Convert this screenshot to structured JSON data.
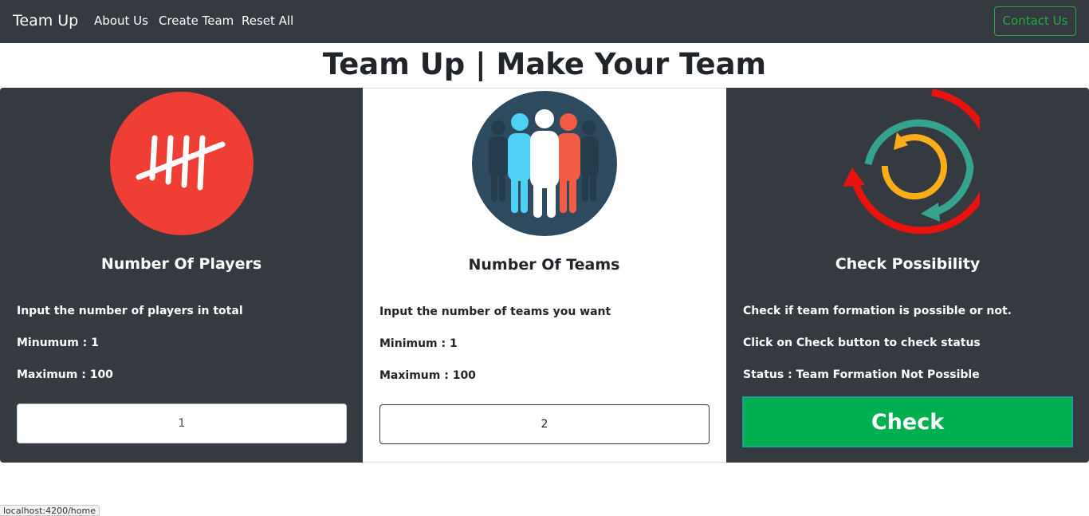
{
  "navbar": {
    "brand": "Team Up",
    "links": [
      "About Us",
      "Create Team",
      "Reset All"
    ],
    "contact_label": "Contact Us"
  },
  "page_title": "Team Up | Make Your Team",
  "cards": [
    {
      "icon": "tally-marks-icon",
      "title": "Number Of Players",
      "lines": [
        "Input the number of players in total",
        "Minumum : 1",
        "Maximum : 100"
      ],
      "input_value": "1"
    },
    {
      "icon": "people-group-icon",
      "title": "Number Of Teams",
      "lines": [
        "Input the number of teams you want",
        "Minimum : 1",
        "Maximum : 100"
      ],
      "input_value": "2"
    },
    {
      "icon": "refresh-arrows-icon",
      "title": "Check Possibility",
      "lines": [
        "Check if team formation is possible or not.",
        "Click on Check button to check status",
        "Status : Team Formation Not Possible"
      ],
      "button_label": "Check"
    }
  ],
  "status_bar_url": "localhost:4200/home",
  "colors": {
    "navbar_bg": "#343a40",
    "contact_accent": "#28a745",
    "check_button": "#00b050",
    "tally_circle": "#ef3e36",
    "people_circle": "#2d4a5e"
  }
}
